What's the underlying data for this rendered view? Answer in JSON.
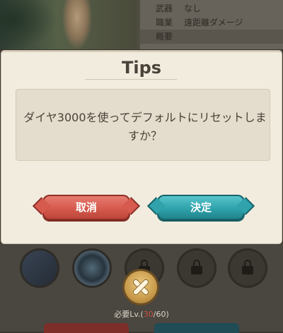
{
  "background": {
    "info_rows": [
      {
        "key": "武器",
        "value": "なし"
      },
      {
        "key": "職業",
        "value": "遠距離ダメージ"
      },
      {
        "key": "概要",
        "value": ""
      }
    ],
    "requirement": {
      "prefix": "必要Lv.(",
      "current": "30",
      "suffix": "/60)"
    }
  },
  "dialog": {
    "title": "Tips",
    "message": "ダイヤ3000を使ってデフォルトにリセットしますか？",
    "cancel_label": "取消",
    "confirm_label": "決定"
  },
  "colors": {
    "cancel": "#d65a4e",
    "confirm": "#2fa2ab",
    "dialog_bg": "#f2ecdf"
  },
  "icons": {
    "close": "close-icon",
    "lock": "lock-icon"
  }
}
